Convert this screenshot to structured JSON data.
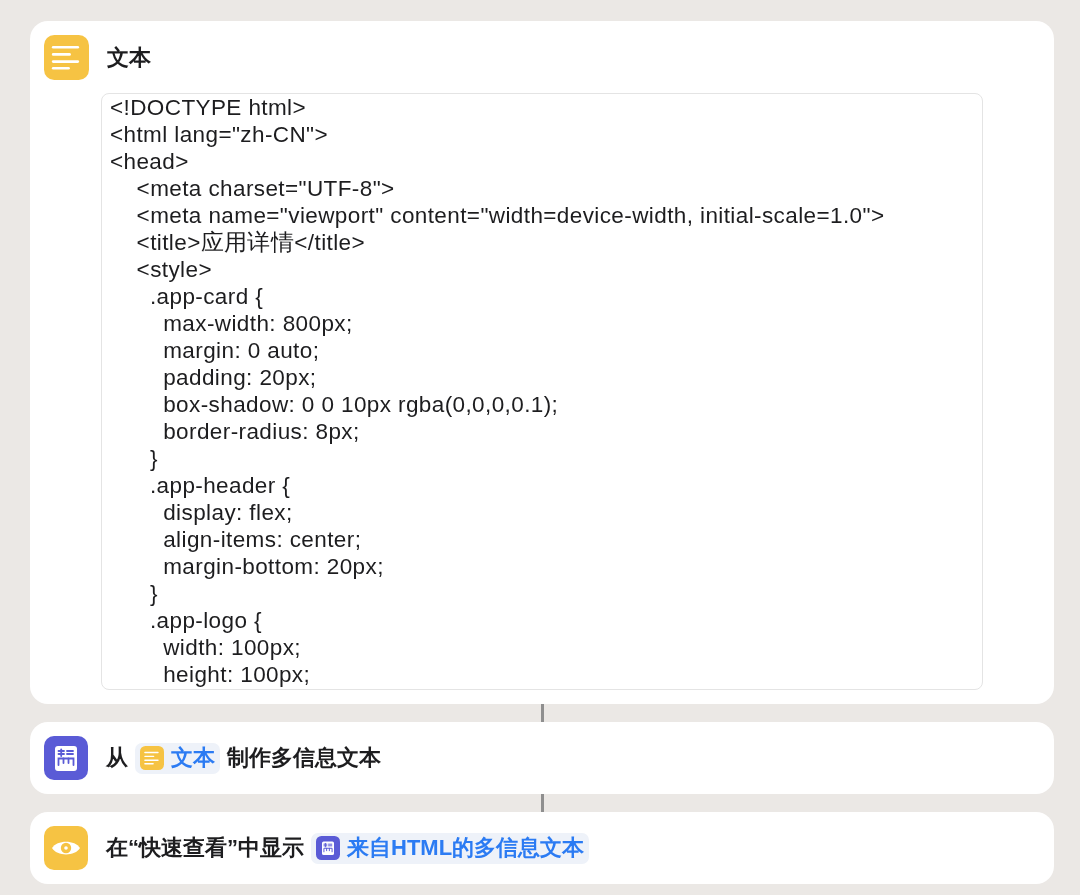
{
  "actions": [
    {
      "kind": "text",
      "title": "文本",
      "text_lines": [
        "<!DOCTYPE html>",
        "<html lang=\"zh-CN\">",
        "<head>",
        "    <meta charset=\"UTF-8\">",
        "    <meta name=\"viewport\" content=\"width=device-width, initial-scale=1.0\">",
        "    <title>应用详情</title>",
        "    <style>",
        "      .app-card {",
        "        max-width: 800px;",
        "        margin: 0 auto;",
        "        padding: 20px;",
        "        box-shadow: 0 0 10px rgba(0,0,0,0.1);",
        "        border-radius: 8px;",
        "      }",
        "      .app-header {",
        "        display: flex;",
        "        align-items: center;",
        "        margin-bottom: 20px;",
        "      }",
        "      .app-logo {",
        "        width: 100px;",
        "        height: 100px;"
      ]
    },
    {
      "kind": "make_rich_text",
      "parts": [
        {
          "kind": "label",
          "text": "从"
        },
        {
          "kind": "text_variable",
          "text": "文本"
        },
        {
          "kind": "label",
          "text": "制作多信息文本"
        }
      ]
    },
    {
      "kind": "quick_look",
      "parts": [
        {
          "kind": "label",
          "text": "在“快速查看”中显示"
        },
        {
          "kind": "rich_text_variable",
          "text": "来自HTML的多信息文本"
        }
      ]
    }
  ]
}
